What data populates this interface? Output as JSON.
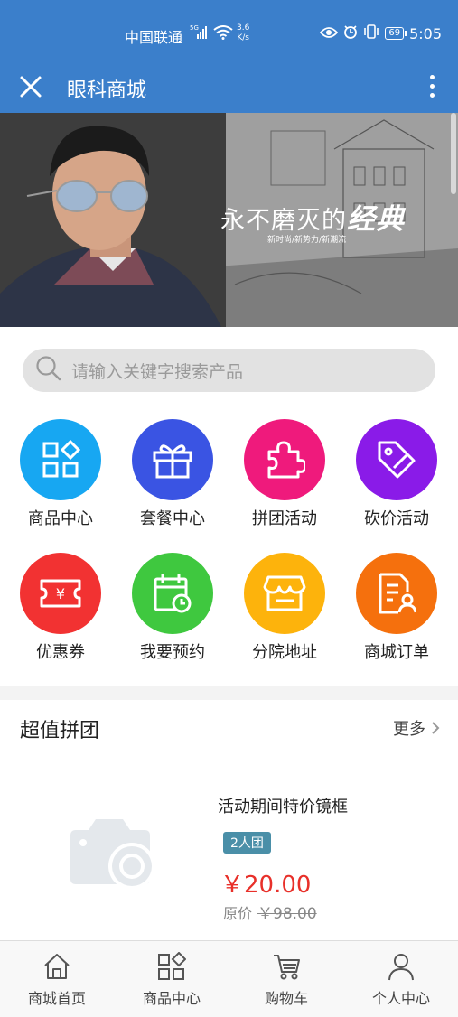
{
  "status_bar": {
    "carrier": "中国联通",
    "network": "5G",
    "speed_value": "3.6",
    "speed_unit": "K/s",
    "battery": "69",
    "time": "5:05"
  },
  "title_bar": {
    "title": "眼科商城",
    "close_icon": "close-icon",
    "more_icon": "more-vertical-icon"
  },
  "banner": {
    "slogan": "永不磨灭的",
    "slogan_bold": "经典",
    "subtitle": "新时尚/新势力/新潮流"
  },
  "search": {
    "placeholder": "请输入关键字搜索产品"
  },
  "grid": [
    {
      "label": "商品中心",
      "color": "#17a7f2",
      "icon": "grid-icon"
    },
    {
      "label": "套餐中心",
      "color": "#3a54e3",
      "icon": "gift-icon"
    },
    {
      "label": "拼团活动",
      "color": "#ef1a7c",
      "icon": "puzzle-icon"
    },
    {
      "label": "砍价活动",
      "color": "#8a1be8",
      "icon": "tag-icon"
    },
    {
      "label": "优惠券",
      "color": "#f23232",
      "icon": "coupon-icon"
    },
    {
      "label": "我要预约",
      "color": "#3fc83f",
      "icon": "calendar-icon"
    },
    {
      "label": "分院地址",
      "color": "#fdb30c",
      "icon": "store-icon"
    },
    {
      "label": "商城订单",
      "color": "#f5700d",
      "icon": "order-icon"
    }
  ],
  "group_buy": {
    "title": "超值拼团",
    "more": "更多",
    "product": {
      "name": "活动期间特价镜框",
      "badge": "2人团",
      "price": "￥20.00",
      "original_label": "原价",
      "original_price": "￥98.00"
    }
  },
  "bottom_nav": [
    {
      "label": "商城首页",
      "icon": "home-icon"
    },
    {
      "label": "商品中心",
      "icon": "grid-icon"
    },
    {
      "label": "购物车",
      "icon": "cart-icon"
    },
    {
      "label": "个人中心",
      "icon": "user-icon"
    }
  ],
  "colors": {
    "header": "#3b7fcb",
    "price": "#e8302a",
    "badge": "#4a8fa8"
  }
}
